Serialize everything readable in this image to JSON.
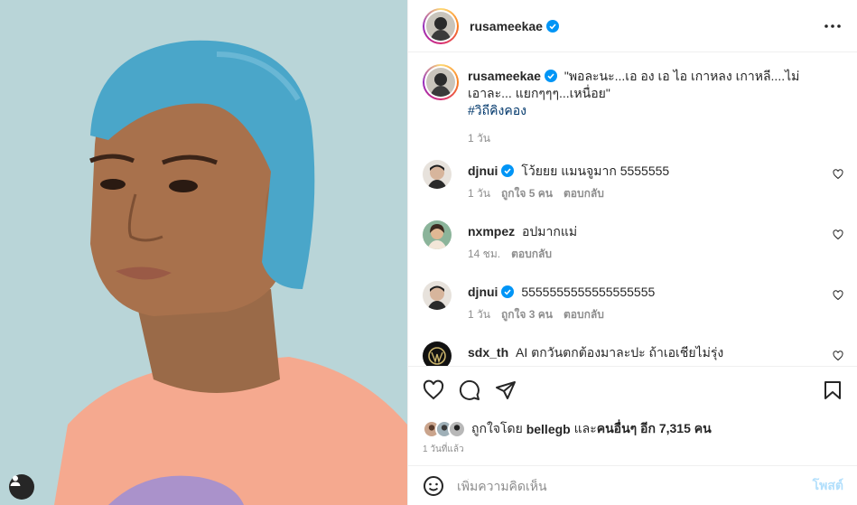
{
  "post": {
    "author": "rusameekae",
    "verified": true
  },
  "caption": {
    "username": "rusameekae",
    "text": "\"พอละนะ...เอ อง เอ ไอ เกาหลง เกาหลี....ไม่เอาละ... แยกๆๆๆ...เหนื่อย\"",
    "hashtag": "#วิถีคิงคอง",
    "time": "1 วัน"
  },
  "comments": [
    {
      "username": "djnui",
      "verified": true,
      "text": "โว้ยยย แมนจูมาก 5555555",
      "time": "1 วัน",
      "likes": "ถูกใจ 5 คน",
      "reply": "ตอบกลับ"
    },
    {
      "username": "nxmpez",
      "verified": false,
      "text": "อปมากแม่",
      "time": "14 ชม.",
      "likes": "",
      "reply": "ตอบกลับ"
    },
    {
      "username": "djnui",
      "verified": true,
      "text": "5555555555555555555",
      "time": "1 วัน",
      "likes": "ถูกใจ 3 คน",
      "reply": "ตอบกลับ"
    },
    {
      "username": "sdx_th",
      "verified": false,
      "text": "AI ตกวันตกต้องมาละปะ ถ้าเอเชียไม่รุ่ง",
      "time": "",
      "likes": "",
      "reply": ""
    }
  ],
  "likes": {
    "prefix": "ถูกใจโดย",
    "user": "bellegb",
    "and": "และ",
    "others": "คนอื่นๆ อีก 7,315 คน"
  },
  "time_ago": "1 วันที่แล้ว",
  "add_comment": {
    "placeholder": "เพิ่มความคิดเห็น",
    "post_label": "โพสต์"
  },
  "colors": {
    "verified": "#0095f6",
    "link": "#00376b",
    "muted": "#8e8e8e",
    "post_disabled": "#b2dffc",
    "hair": "#4aa6c9",
    "shirt": "#f5a98f",
    "background": "#b7d3d6"
  },
  "icons": [
    "more-icon",
    "heart-icon",
    "comment-icon",
    "share-icon",
    "save-icon",
    "emoji-icon",
    "user-tag-icon",
    "verified-icon"
  ]
}
